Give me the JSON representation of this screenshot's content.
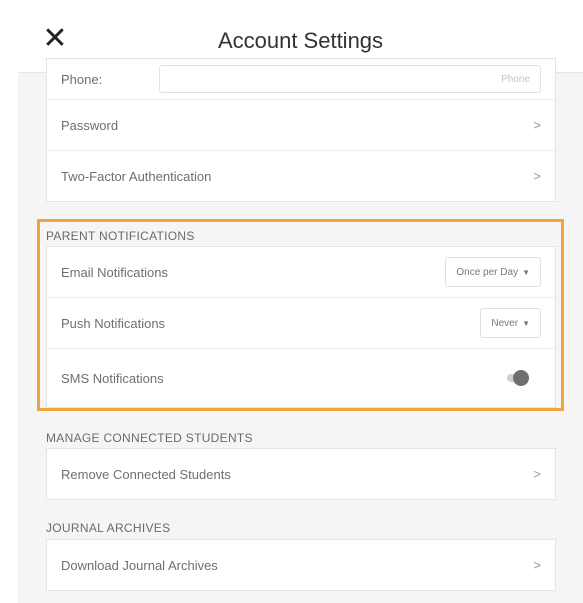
{
  "header": {
    "title": "Account Settings",
    "close_icon": "close-icon"
  },
  "account": {
    "phone_label": "Phone:",
    "phone_placeholder": "Phone",
    "password_label": "Password",
    "two_factor_label": "Two-Factor Authentication",
    "chevron": ">"
  },
  "parent_notifications": {
    "section_title": "PARENT NOTIFICATIONS",
    "email_label": "Email Notifications",
    "email_value": "Once per Day",
    "push_label": "Push Notifications",
    "push_value": "Never",
    "sms_label": "SMS Notifications",
    "sms_enabled": false
  },
  "manage_students": {
    "section_title": "MANAGE CONNECTED STUDENTS",
    "remove_label": "Remove Connected Students",
    "chevron": ">"
  },
  "journal_archives": {
    "section_title": "JOURNAL ARCHIVES",
    "download_label": "Download Journal Archives",
    "chevron": ">"
  },
  "colors": {
    "highlight": "#f0a53a",
    "background": "#f5f5f5"
  }
}
